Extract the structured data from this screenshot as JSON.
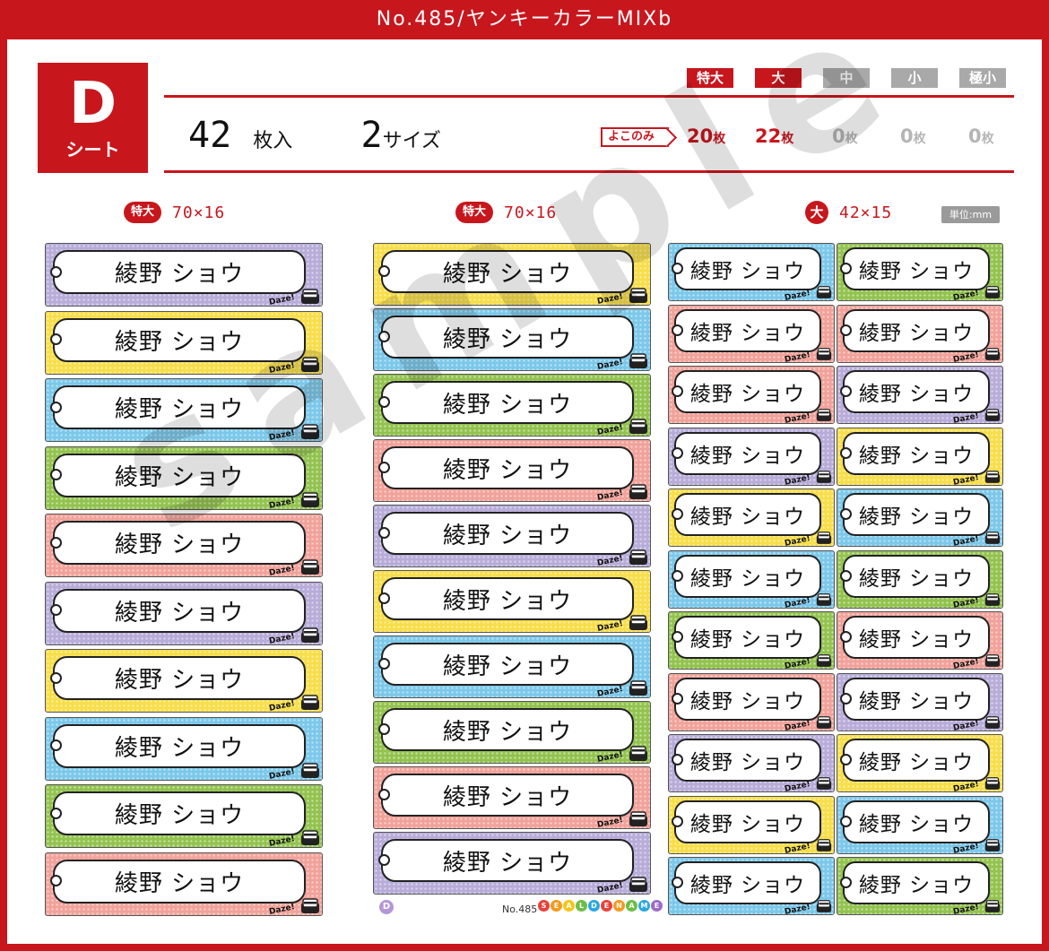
{
  "title": "No.485/ヤンキーカラーMIXb",
  "sheet": {
    "letter": "D",
    "word": "シート"
  },
  "summary": {
    "total": "42",
    "total_unit": "枚入",
    "sizes": "2",
    "sizes_unit": "サイズ"
  },
  "size_tags": [
    {
      "label": "特大",
      "active": true
    },
    {
      "label": "大",
      "active": true
    },
    {
      "label": "中",
      "active": false
    },
    {
      "label": "小",
      "active": false
    },
    {
      "label": "極小",
      "active": false
    }
  ],
  "yokonomi": "よこのみ",
  "counts": [
    {
      "num": "20",
      "unit": "枚",
      "active": true
    },
    {
      "num": "22",
      "unit": "枚",
      "active": true
    },
    {
      "num": "0",
      "unit": "枚",
      "active": false
    },
    {
      "num": "0",
      "unit": "枚",
      "active": false
    },
    {
      "num": "0",
      "unit": "枚",
      "active": false
    }
  ],
  "columns": [
    {
      "tag": "特大",
      "dims": "70×16"
    },
    {
      "tag": "特大",
      "dims": "70×16"
    },
    {
      "tag": "大",
      "dims": "42×15"
    }
  ],
  "unit_note": "単位:mm",
  "label_text": "綾野 ショウ",
  "label_daze": "Daze!",
  "watermark": "sample",
  "footer": {
    "badge": "D",
    "number": "No.485",
    "logo_letters": [
      "S",
      "E",
      "A",
      "L",
      "D",
      "E",
      "N",
      "A",
      "M",
      "E"
    ]
  },
  "colors": {
    "accent": "#c8161d",
    "purple": "#b8acd9",
    "yellow": "#f7de4a",
    "blue": "#7cc8ea",
    "green": "#93c34f",
    "pink": "#f1a29a"
  },
  "col1_colors": [
    "purple",
    "yellow",
    "blue",
    "green",
    "pink",
    "purple",
    "yellow",
    "blue",
    "green",
    "pink"
  ],
  "col2_colors": [
    "yellow",
    "blue",
    "green",
    "pink",
    "purple",
    "yellow",
    "blue",
    "green",
    "pink",
    "purple"
  ],
  "col3_colors": [
    "blue",
    "pink",
    "pink",
    "purple",
    "yellow",
    "blue",
    "green",
    "pink",
    "purple",
    "yellow",
    "blue"
  ],
  "col4_colors": [
    "green",
    "pink",
    "purple",
    "yellow",
    "blue",
    "green",
    "pink",
    "purple",
    "yellow",
    "blue",
    "green"
  ]
}
